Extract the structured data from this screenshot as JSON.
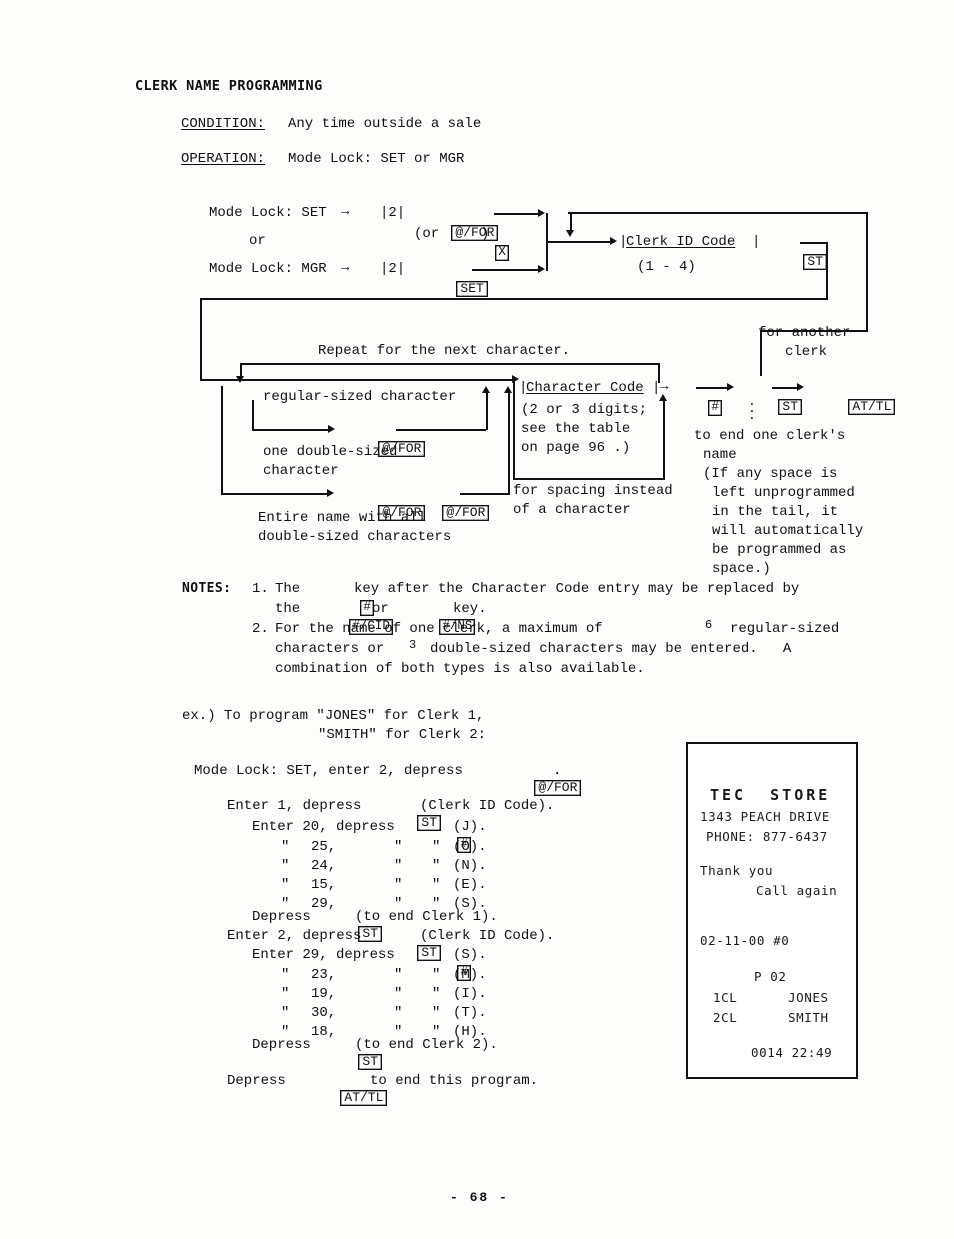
{
  "document": {
    "title": "CLERK NAME PROGRAMMING",
    "page_number": "- 68 -"
  },
  "header": {
    "condition_label": "CONDITION:",
    "condition_value": "Any time outside a sale",
    "operation_label": "OPERATION:",
    "operation_value": "Mode Lock: SET or MGR"
  },
  "flow": {
    "mode_set": "Mode Lock: SET",
    "arrow": "→",
    "num2": "|2|",
    "key_atfor": "@/FOR",
    "or_text": "or",
    "or_paren_open": "(or",
    "key_x": "X",
    "or_paren_close": ")",
    "mode_mgr": "Mode Lock: MGR",
    "key_set": "SET",
    "clerk_id_code": "Clerk ID Code",
    "clerk_id_range": "(1 - 4)",
    "key_st": "ST",
    "repeat_label": "Repeat for the next character.",
    "regular_sized": "regular-sized character",
    "one_double_l1": "one double-sized",
    "one_double_l2": "character",
    "entire_name_l1": "Entire name with all",
    "entire_name_l2": "double-sized characters",
    "character_code": "Character Code",
    "char_note_l1": "(2 or 3 digits;",
    "char_note_l2": "see the table",
    "char_note_l3": "on page 96 .)",
    "key_hash": "#",
    "key_attl": "AT/TL",
    "for_another_l1": "for another",
    "for_another_l2": "clerk",
    "spacing_l1": "for spacing instead",
    "spacing_l2": "of a character",
    "end_clerk_l1": "to end one clerk's",
    "end_clerk_l2": "name",
    "end_clerk_l3": "(If any space is",
    "end_clerk_l4": "left unprogrammed",
    "end_clerk_l5": "in the tail, it",
    "end_clerk_l6": "will automatically",
    "end_clerk_l7": "be programmed as",
    "end_clerk_l8": "space.)"
  },
  "notes": {
    "label": "NOTES:",
    "items": [
      {
        "number": "1.",
        "part1": "The",
        "key1": "#",
        "part2": "key after the Character Code entry may be replaced by",
        "part3": "the",
        "key2": "#/CID",
        "part4": "or",
        "key3": "#/NS",
        "part5": "key."
      },
      {
        "number": "2.",
        "line1_a": "For the name of one clerk, a maximum of",
        "line1_n": "6",
        "line1_b": "regular-sized",
        "line2_a": "characters or",
        "line2_n": "3",
        "line2_b": "double-sized characters may be entered.   A",
        "line3": "combination of both types is also available."
      }
    ]
  },
  "example": {
    "intro_l1": "ex.) To program \"JONES\" for Clerk 1,",
    "intro_l2": "\"SMITH\" for Clerk 2:",
    "modelock_a": "Mode Lock: SET, enter 2, depress",
    "modelock_key": "@/FOR",
    "modelock_b": ".",
    "clerk1": {
      "id_a": "Enter 1, depress",
      "id_key": "ST",
      "id_b": "(Clerk ID Code).",
      "first_a": "Enter 20, depress",
      "first_key": "#",
      "first_b": "(J).",
      "rows": [
        {
          "ditto1": "\"",
          "code": "25,",
          "ditto2": "\"",
          "ditto3": "\"",
          "letter": "(O)."
        },
        {
          "ditto1": "\"",
          "code": "24,",
          "ditto2": "\"",
          "ditto3": "\"",
          "letter": "(N)."
        },
        {
          "ditto1": "\"",
          "code": "15,",
          "ditto2": "\"",
          "ditto3": "\"",
          "letter": "(E)."
        },
        {
          "ditto1": "\"",
          "code": "29,",
          "ditto2": "\"",
          "ditto3": "\"",
          "letter": "(S)."
        }
      ],
      "end_a": "Depress",
      "end_key": "ST",
      "end_b": "(to end Clerk 1)."
    },
    "clerk2": {
      "id_a": "Enter 2, depress",
      "id_key": "ST",
      "id_b": "(Clerk ID Code).",
      "first_a": "Enter 29, depress",
      "first_key": "#",
      "first_b": "(S).",
      "rows": [
        {
          "ditto1": "\"",
          "code": "23,",
          "ditto2": "\"",
          "ditto3": "\"",
          "letter": "(M)."
        },
        {
          "ditto1": "\"",
          "code": "19,",
          "ditto2": "\"",
          "ditto3": "\"",
          "letter": "(I)."
        },
        {
          "ditto1": "\"",
          "code": "30,",
          "ditto2": "\"",
          "ditto3": "\"",
          "letter": "(T)."
        },
        {
          "ditto1": "\"",
          "code": "18,",
          "ditto2": "\"",
          "ditto3": "\"",
          "letter": "(H)."
        }
      ],
      "end_a": "Depress",
      "end_key": "ST",
      "end_b": "(to end Clerk 2)."
    },
    "final_a": "Depress",
    "final_key": "AT/TL",
    "final_b": "to end this program."
  },
  "receipt": {
    "store": "TEC  STORE",
    "address": "1343 PEACH DRIVE",
    "phone": "PHONE: 877-6437",
    "thanks": "Thank you",
    "call_again": "Call again",
    "date": "02-11-00 #0",
    "p_code": "P 02",
    "clerk1_id": "1CL",
    "clerk1_name": "JONES",
    "clerk2_id": "2CL",
    "clerk2_name": "SMITH",
    "counter_time": "0014 22:49"
  }
}
